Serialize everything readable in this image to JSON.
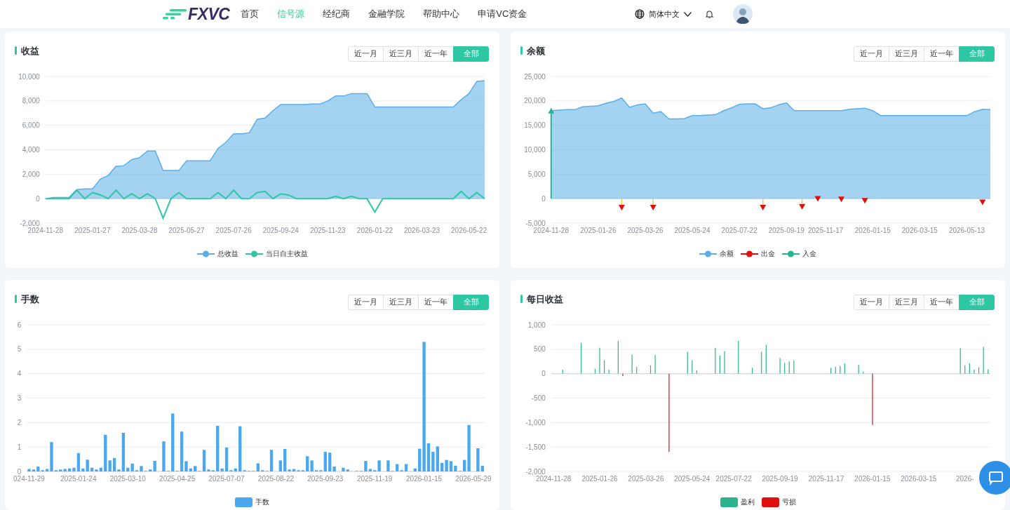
{
  "header": {
    "logo": "FXVC",
    "nav": [
      {
        "label": "首页",
        "selected": false
      },
      {
        "label": "信号源",
        "selected": true
      },
      {
        "label": "经纪商",
        "selected": false
      },
      {
        "label": "金融学院",
        "selected": false
      },
      {
        "label": "帮助中心",
        "selected": false
      },
      {
        "label": "申请VC资金",
        "selected": false
      }
    ],
    "language": "简体中文"
  },
  "cards": [
    {
      "title": "收益",
      "ranges": [
        {
          "label": "近一月",
          "selected": false
        },
        {
          "label": "近三月",
          "selected": false
        },
        {
          "label": "近一年",
          "selected": false
        },
        {
          "label": "全部",
          "selected": true
        }
      ],
      "chart_data": {
        "type": "area",
        "grid": true,
        "ylim": [
          -2000,
          10000
        ],
        "yticks": [
          {
            "value": -2000,
            "label": "-2,000"
          },
          {
            "value": 0,
            "label": "0"
          },
          {
            "value": 2000,
            "label": "2,000"
          },
          {
            "value": 4000,
            "label": "4,000"
          },
          {
            "value": 6000,
            "label": "6,000"
          },
          {
            "value": 8000,
            "label": "8,000"
          },
          {
            "value": 10000,
            "label": "10,000"
          }
        ],
        "categories": [
          "2024-11-28",
          null,
          null,
          null,
          null,
          null,
          "2025-01-27",
          null,
          null,
          null,
          null,
          null,
          "2025-03-28",
          null,
          null,
          null,
          null,
          null,
          "2025-05-27",
          null,
          null,
          null,
          null,
          null,
          "2025-07-26",
          null,
          null,
          null,
          null,
          null,
          "2025-09-24",
          null,
          null,
          null,
          null,
          null,
          "2025-11-23",
          null,
          null,
          null,
          null,
          null,
          "2026-01-22",
          null,
          null,
          null,
          null,
          null,
          "2026-03-23",
          null,
          null,
          null,
          null,
          null,
          "2026-05-22",
          null,
          null
        ],
        "series": [
          {
            "name": "总收益",
            "color": "#5aaee8",
            "type": "area",
            "values": [
              0,
              100,
              100,
              100,
              750,
              800,
              800,
              1600,
              1900,
              2650,
              2700,
              3200,
              3350,
              3900,
              3900,
              2300,
              2300,
              2300,
              3100,
              3100,
              3100,
              3100,
              4100,
              4600,
              5300,
              5300,
              5400,
              6500,
              6600,
              7200,
              7700,
              7700,
              7700,
              7700,
              7750,
              7750,
              8000,
              8400,
              8400,
              8600,
              8600,
              8600,
              7500,
              7500,
              7500,
              7500,
              7500,
              7500,
              7500,
              7500,
              7500,
              7500,
              7500,
              8100,
              8600,
              9600,
              9650
            ]
          },
          {
            "name": "当日自主收益",
            "color": "#2ec7a4",
            "type": "line",
            "values": [
              0,
              0,
              0,
              0,
              700,
              0,
              500,
              300,
              0,
              700,
              0,
              400,
              0,
              400,
              0,
              -1600,
              0,
              500,
              0,
              0,
              0,
              0,
              500,
              0,
              700,
              0,
              0,
              500,
              600,
              0,
              400,
              300,
              0,
              0,
              0,
              0,
              0,
              200,
              0,
              200,
              0,
              0,
              -1100,
              0,
              0,
              0,
              0,
              0,
              0,
              0,
              0,
              0,
              0,
              600,
              0,
              500,
              0
            ]
          }
        ]
      }
    },
    {
      "title": "余额",
      "ranges": [
        {
          "label": "近一月",
          "selected": false
        },
        {
          "label": "近三月",
          "selected": false
        },
        {
          "label": "近一年",
          "selected": false
        },
        {
          "label": "全部",
          "selected": true
        }
      ],
      "chart_data": {
        "type": "area",
        "grid": true,
        "ylim": [
          -5000,
          25000
        ],
        "yticks": [
          {
            "value": -5000,
            "label": "-5,000"
          },
          {
            "value": 0,
            "label": "0"
          },
          {
            "value": 5000,
            "label": "5,000"
          },
          {
            "value": 10000,
            "label": "10,000"
          },
          {
            "value": 15000,
            "label": "15,000"
          },
          {
            "value": 20000,
            "label": "20,000"
          },
          {
            "value": 25000,
            "label": "25,000"
          }
        ],
        "categories": [
          "2024-11-28",
          null,
          null,
          null,
          null,
          null,
          "2025-01-26",
          null,
          null,
          null,
          null,
          null,
          "2025-03-26",
          null,
          null,
          null,
          null,
          null,
          "2025-05-24",
          null,
          null,
          null,
          null,
          null,
          "2025-07-22",
          null,
          null,
          null,
          null,
          null,
          "2025-09-19",
          null,
          null,
          null,
          null,
          "2025-11-17",
          null,
          null,
          null,
          null,
          null,
          "2026-01-15",
          null,
          null,
          null,
          null,
          null,
          "2026-03-15",
          null,
          null,
          null,
          null,
          null,
          "2026-05-13",
          null,
          null,
          null
        ],
        "series": [
          {
            "name": "余额",
            "color": "#5aaee8",
            "type": "area",
            "values": [
              18000,
              18100,
              18200,
              18200,
              18800,
              18900,
              19000,
              19500,
              19900,
              20600,
              18700,
              19200,
              19400,
              17500,
              17800,
              16300,
              16300,
              16400,
              17000,
              17000,
              17100,
              17200,
              18000,
              18600,
              19300,
              19400,
              19400,
              18400,
              18600,
              19200,
              19600,
              18000,
              18000,
              18000,
              18000,
              18000,
              18000,
              18000,
              18300,
              18400,
              18500,
              18000,
              17000,
              17000,
              17000,
              17000,
              17000,
              17000,
              17000,
              17000,
              17000,
              17000,
              17000,
              17000,
              17800,
              18300,
              18200
            ]
          },
          {
            "name": "出金",
            "color": "#e01010",
            "type": "scatter",
            "values": [
              null,
              null,
              null,
              null,
              null,
              null,
              null,
              null,
              null,
              -2000,
              null,
              null,
              null,
              -2000,
              null,
              null,
              null,
              null,
              null,
              null,
              null,
              null,
              null,
              null,
              null,
              null,
              null,
              -2000,
              null,
              null,
              null,
              null,
              -1800,
              null,
              -200,
              null,
              null,
              -300,
              null,
              null,
              -600,
              null,
              null,
              null,
              null,
              null,
              null,
              null,
              null,
              null,
              null,
              null,
              null,
              null,
              null,
              -900,
              null
            ]
          },
          {
            "name": "入金",
            "color": "#26b495",
            "type": "scatter",
            "values": [
              18000,
              null,
              null,
              null,
              null,
              null,
              null,
              null,
              null,
              null,
              null,
              null,
              null,
              null,
              null,
              null,
              null,
              null,
              null,
              null,
              null,
              null,
              null,
              null,
              null,
              null,
              null,
              null,
              null,
              null,
              null,
              null,
              null,
              null,
              null,
              null,
              null,
              null,
              null,
              null,
              null,
              null,
              null,
              null,
              null,
              null,
              null,
              null,
              null,
              null,
              null,
              null,
              null,
              null,
              null,
              null,
              null
            ]
          }
        ]
      }
    },
    {
      "title": "手数",
      "ranges": [
        {
          "label": "近一月",
          "selected": false
        },
        {
          "label": "近三月",
          "selected": false
        },
        {
          "label": "近一年",
          "selected": false
        },
        {
          "label": "全部",
          "selected": true
        }
      ],
      "chart_data": {
        "type": "bar",
        "grid": true,
        "ylim": [
          0,
          6
        ],
        "yticks": [
          0,
          1,
          2,
          3,
          4,
          5,
          6
        ],
        "categories": [
          "024-11-29",
          null,
          null,
          null,
          null,
          null,
          null,
          null,
          null,
          null,
          null,
          "2025-01-24",
          null,
          null,
          null,
          null,
          null,
          null,
          null,
          null,
          null,
          null,
          "2025-03-10",
          null,
          null,
          null,
          null,
          null,
          null,
          null,
          null,
          null,
          null,
          "2025-04-25",
          null,
          null,
          null,
          null,
          null,
          null,
          null,
          null,
          null,
          null,
          "2025-07-07",
          null,
          null,
          null,
          null,
          null,
          null,
          null,
          null,
          null,
          null,
          "2025-08-22",
          null,
          null,
          null,
          null,
          null,
          null,
          null,
          null,
          null,
          null,
          "2025-09-23",
          null,
          null,
          null,
          null,
          null,
          null,
          null,
          null,
          null,
          null,
          "2025-11-19",
          null,
          null,
          null,
          null,
          null,
          null,
          null,
          null,
          null,
          null,
          "2026-01-15",
          null,
          null,
          null,
          null,
          null,
          null,
          null,
          null,
          null,
          null,
          "2026-05-29",
          null,
          null
        ],
        "series": [
          {
            "name": "手数",
            "color": "#4aa8ef",
            "type": "bar",
            "values": [
              0.1,
              0.08,
              0.2,
              0.05,
              0.1,
              1.2,
              0.05,
              0.08,
              0.1,
              0.12,
              0.15,
              0.75,
              0.12,
              0.48,
              0.15,
              0.08,
              0.15,
              1.5,
              0.45,
              0.55,
              0.08,
              1.58,
              0.15,
              0.32,
              0.05,
              0.22,
              0.02,
              0.08,
              0.43,
              0,
              1.23,
              0.02,
              2.37,
              0.02,
              1.63,
              0.42,
              0.12,
              0.22,
              0.02,
              0.88,
              0.08,
              0.05,
              1.87,
              0.12,
              0.98,
              0.05,
              0.12,
              1.85,
              0.05,
              0.02,
              0.02,
              0.33,
              0.05,
              0.02,
              0.88,
              0,
              0.45,
              0.92,
              0.08,
              0.1,
              0.05,
              0.05,
              0.62,
              0.45,
              0.05,
              0.05,
              0.8,
              0.77,
              0.2,
              0,
              0.15,
              0.08,
              0,
              0.02,
              0.02,
              0.43,
              0.1,
              0.05,
              0.45,
              0,
              0.45,
              0.02,
              0.3,
              0.05,
              0.3,
              0,
              0.12,
              0.93,
              5.3,
              1.15,
              0.8,
              1.02,
              0.35,
              0.47,
              0.42,
              0.23,
              0.02,
              0.47,
              1.9,
              0,
              0.95,
              0.23
            ]
          }
        ]
      }
    },
    {
      "title": "每日收益",
      "ranges": [
        {
          "label": "近一月",
          "selected": false
        },
        {
          "label": "近三月",
          "selected": false
        },
        {
          "label": "近一年",
          "selected": false
        },
        {
          "label": "全部",
          "selected": true
        }
      ],
      "chart_data": {
        "type": "bar",
        "grid": true,
        "ylim": [
          -2000,
          1000
        ],
        "yticks": [
          {
            "value": -2000,
            "label": "-2,000"
          },
          {
            "value": -1500,
            "label": "-1,500"
          },
          {
            "value": -1000,
            "label": "-1,000"
          },
          {
            "value": -500,
            "label": "-500"
          },
          {
            "value": 0,
            "label": "0"
          },
          {
            "value": 500,
            "label": "500"
          },
          {
            "value": 1000,
            "label": "1,000"
          }
        ],
        "categories": [
          "2024-11-28",
          null,
          null,
          null,
          null,
          null,
          null,
          null,
          null,
          null,
          "2025-01-26",
          null,
          null,
          null,
          null,
          null,
          null,
          null,
          null,
          null,
          "2025-03-26",
          null,
          null,
          null,
          null,
          null,
          null,
          null,
          null,
          null,
          "2025-05-24",
          null,
          null,
          null,
          null,
          null,
          null,
          null,
          null,
          "2025-07-22",
          null,
          null,
          null,
          null,
          null,
          null,
          null,
          null,
          null,
          "2025-09-19",
          null,
          null,
          null,
          null,
          null,
          null,
          null,
          null,
          null,
          "2025-11-17",
          null,
          null,
          null,
          null,
          null,
          null,
          null,
          null,
          null,
          "2026-01-15",
          null,
          null,
          null,
          null,
          null,
          null,
          null,
          null,
          null,
          "2026-03-15",
          null,
          null,
          null,
          null,
          null,
          null,
          null,
          null,
          null,
          "2026-",
          null,
          null,
          null,
          null,
          null
        ],
        "series": [
          {
            "name": "盈利",
            "color": "#2db38e",
            "type": "bar",
            "values": [
              null,
              null,
              80,
              null,
              null,
              null,
              630,
              null,
              null,
              100,
              530,
              270,
              80,
              null,
              670,
              null,
              null,
              390,
              140,
              null,
              null,
              170,
              380,
              null,
              null,
              null,
              null,
              null,
              null,
              450,
              270,
              70,
              null,
              null,
              null,
              530,
              370,
              460,
              null,
              null,
              670,
              null,
              null,
              120,
              null,
              450,
              590,
              null,
              null,
              320,
              220,
              250,
              270,
              null,
              null,
              null,
              null,
              null,
              null,
              null,
              120,
              140,
              160,
              210,
              null,
              null,
              180,
              40,
              null,
              null,
              null,
              null,
              null,
              null,
              null,
              null,
              null,
              null,
              null,
              null,
              null,
              null,
              null,
              null,
              null,
              null,
              null,
              null,
              520,
              170,
              210,
              80,
              130,
              550,
              90
            ]
          },
          {
            "name": "亏损",
            "color": "#e01010",
            "type": "bar",
            "values": [
              null,
              null,
              null,
              null,
              null,
              null,
              null,
              null,
              null,
              null,
              null,
              null,
              null,
              null,
              null,
              -50,
              null,
              null,
              null,
              null,
              null,
              null,
              null,
              null,
              null,
              -1600,
              null,
              null,
              null,
              null,
              null,
              null,
              null,
              null,
              null,
              null,
              null,
              null,
              null,
              null,
              null,
              null,
              null,
              null,
              null,
              null,
              null,
              null,
              null,
              null,
              null,
              null,
              null,
              null,
              null,
              null,
              null,
              null,
              null,
              null,
              null,
              null,
              null,
              null,
              null,
              null,
              null,
              null,
              null,
              -1050,
              null,
              null,
              null,
              null,
              null,
              null,
              null,
              null,
              null,
              null,
              null,
              null,
              null,
              null,
              null,
              null,
              null,
              null,
              null,
              null,
              null,
              null,
              null,
              null,
              null
            ]
          }
        ]
      }
    }
  ]
}
